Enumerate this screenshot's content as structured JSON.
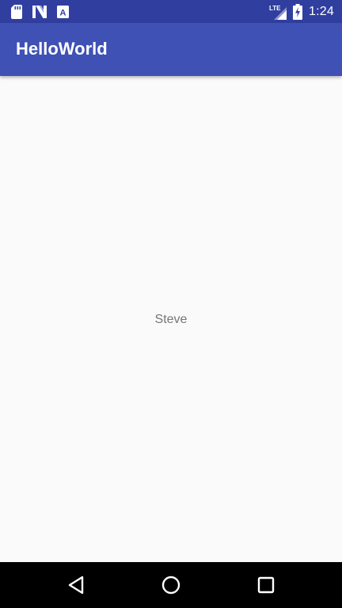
{
  "status_bar": {
    "time": "1:24",
    "network_label": "LTE",
    "notification_icons": [
      "sd-card-icon",
      "n-logo-icon",
      "a-badge-icon"
    ],
    "a_badge_text": "A",
    "battery_state": "charging"
  },
  "app_bar": {
    "title": "HelloWorld",
    "color": "#3f51b5",
    "status_color": "#303f9f"
  },
  "main": {
    "text": "Steve"
  },
  "nav_bar": {
    "buttons": [
      "back-icon",
      "home-icon",
      "recents-icon"
    ]
  }
}
